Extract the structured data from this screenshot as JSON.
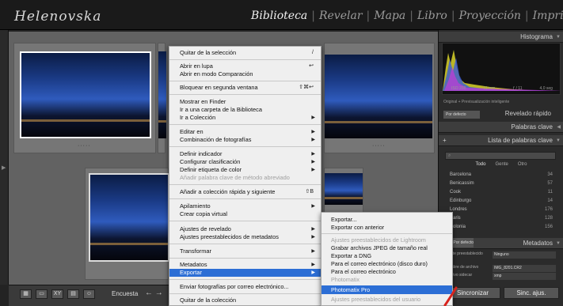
{
  "app": {
    "logo": "Helenovska",
    "modules": [
      {
        "label": "Biblioteca",
        "active": true
      },
      {
        "label": "Revelar",
        "active": false
      },
      {
        "label": "Mapa",
        "active": false
      },
      {
        "label": "Libro",
        "active": false
      },
      {
        "label": "Proyección",
        "active": false
      },
      {
        "label": "Imprimir",
        "active": false
      }
    ]
  },
  "toolbar": {
    "encuesta_label": "Encuesta",
    "arrows": "← →"
  },
  "context_menu": {
    "items": [
      {
        "label": "Quitar de la selección",
        "shortcut": "/"
      },
      {
        "label": "Abrir en lupa",
        "shortcut": "↩"
      },
      {
        "label": "Abrir en modo Comparación"
      },
      {
        "label": "Bloquear en segunda ventana",
        "shortcut": "⇧⌘↩"
      },
      {
        "label": "Mostrar en Finder"
      },
      {
        "label": "Ir a una carpeta de la Biblioteca"
      },
      {
        "label": "Ir a Colección",
        "arrow": "▶"
      },
      {
        "label": "Editar en",
        "arrow": "▶"
      },
      {
        "label": "Combinación de fotografías",
        "arrow": "▶"
      },
      {
        "label": "Definir indicador",
        "arrow": "▶"
      },
      {
        "label": "Configurar clasificación",
        "arrow": "▶"
      },
      {
        "label": "Definir etiqueta de color",
        "arrow": "▶"
      },
      {
        "label": "Añadir palabra clave de método abreviado",
        "disabled": true
      },
      {
        "label": "Añadir a colección rápida y siguiente",
        "shortcut": "⇧B"
      },
      {
        "label": "Apilamiento",
        "arrow": "▶"
      },
      {
        "label": "Crear copia virtual"
      },
      {
        "label": "Ajustes de revelado",
        "arrow": "▶"
      },
      {
        "label": "Ajustes preestablecidos de metadatos",
        "arrow": "▶"
      },
      {
        "label": "Transformar",
        "arrow": "▶"
      },
      {
        "label": "Metadatos",
        "arrow": "▶"
      },
      {
        "label": "Exportar",
        "arrow": "▶"
      },
      {
        "label": "Enviar fotografías por correo electrónico..."
      },
      {
        "label": "Quitar de la colección"
      }
    ]
  },
  "export_submenu": {
    "items": [
      {
        "label": "Exportar..."
      },
      {
        "label": "Exportar con anterior"
      },
      {
        "label": "Ajustes preestablecidos de Lightroom",
        "disabled": true
      },
      {
        "label": "Grabar archivos JPEG de tamaño real"
      },
      {
        "label": "Exportar a DNG"
      },
      {
        "label": "Para el correo electrónico (disco duro)"
      },
      {
        "label": "Para el correo electrónico"
      },
      {
        "label": "Photomatix",
        "disabled": true
      },
      {
        "label": "Photomatix Pro"
      },
      {
        "label": "Ajustes preestablecidos del usuario",
        "disabled": true
      }
    ]
  },
  "right_panel": {
    "histograma": "Histograma",
    "histo_stats": [
      "ISO 200",
      "11 mm",
      "ƒ / 11",
      "4,0 seg"
    ],
    "original": "Original + Previsualización inteligente",
    "quick_select": "Por defecto",
    "revelado_rapido": "Revelado rápido",
    "palabras_clave": "Palabras clave",
    "lista_palabras": "Lista de palabras clave",
    "filters": [
      "Todo",
      "Gente",
      "Otro"
    ],
    "keywords": [
      {
        "name": "Barcelona",
        "count": "34"
      },
      {
        "name": "Benicassim",
        "count": "57"
      },
      {
        "name": "Cook",
        "count": "11"
      },
      {
        "name": "Edinburgo",
        "count": "14"
      },
      {
        "name": "Londres",
        "count": "176"
      },
      {
        "name": "Paris",
        "count": "128"
      },
      {
        "name": "Polonia",
        "count": "156"
      }
    ],
    "meta_select": "Por defecto",
    "metadatos": "Metadatos",
    "meta_rows": [
      {
        "label": "Ajuste preestablecido",
        "value": "Ninguno"
      },
      {
        "label": "Nombre de archivo",
        "value": "IMG_8201.CR2"
      },
      {
        "label": "Archivo sidecar",
        "value": "xmp"
      }
    ],
    "sincronizar": "Sincronizar",
    "sinc_ajustes": "Sinc. ajus."
  }
}
